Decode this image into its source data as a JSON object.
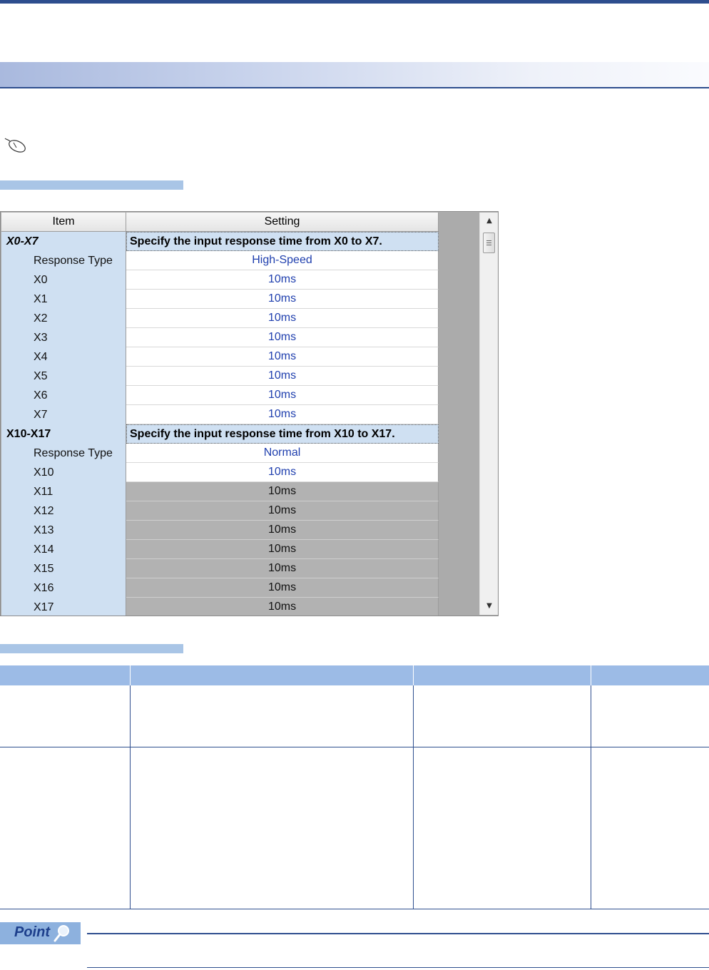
{
  "grid": {
    "header": {
      "item": "Item",
      "setting": "Setting"
    },
    "rows": [
      {
        "item": "X0-X7",
        "setting": "Specify the input response time from X0 to X7.",
        "kind": "group",
        "italic": true
      },
      {
        "item": "Response Type",
        "setting": "High-Speed",
        "kind": "white"
      },
      {
        "item": "X0",
        "setting": "10ms",
        "kind": "white"
      },
      {
        "item": "X1",
        "setting": "10ms",
        "kind": "white"
      },
      {
        "item": "X2",
        "setting": "10ms",
        "kind": "white"
      },
      {
        "item": "X3",
        "setting": "10ms",
        "kind": "white"
      },
      {
        "item": "X4",
        "setting": "10ms",
        "kind": "white"
      },
      {
        "item": "X5",
        "setting": "10ms",
        "kind": "white"
      },
      {
        "item": "X6",
        "setting": "10ms",
        "kind": "white"
      },
      {
        "item": "X7",
        "setting": "10ms",
        "kind": "white"
      },
      {
        "item": "X10-X17",
        "setting": "Specify the input response time from X10 to X17.",
        "kind": "group",
        "italic": false
      },
      {
        "item": "Response Type",
        "setting": "Normal",
        "kind": "white"
      },
      {
        "item": "X10",
        "setting": "10ms",
        "kind": "white"
      },
      {
        "item": "X11",
        "setting": "10ms",
        "kind": "gray"
      },
      {
        "item": "X12",
        "setting": "10ms",
        "kind": "gray"
      },
      {
        "item": "X13",
        "setting": "10ms",
        "kind": "gray"
      },
      {
        "item": "X14",
        "setting": "10ms",
        "kind": "gray"
      },
      {
        "item": "X15",
        "setting": "10ms",
        "kind": "gray"
      },
      {
        "item": "X16",
        "setting": "10ms",
        "kind": "gray"
      },
      {
        "item": "X17",
        "setting": "10ms",
        "kind": "gray"
      }
    ]
  },
  "scrollbar": {
    "up_arrow_glyph": "▲",
    "down_arrow_glyph": "▼"
  },
  "point": {
    "label": "Point"
  },
  "colors": {
    "accent": "#2e4e8e",
    "setting_text": "#1f3fae",
    "item_bg": "#cfe0f2"
  }
}
